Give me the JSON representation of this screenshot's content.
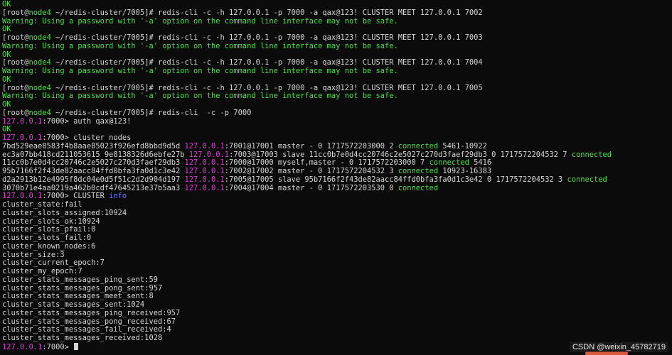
{
  "colors": {
    "background": "#0b0b0b",
    "text": "#d6d6d6",
    "green": "#4be04b",
    "magenta": "#e23bd9",
    "blue": "#6b7bf0",
    "cursor": "#d6d6d6"
  },
  "terminal": {
    "lines": [
      [
        {
          "t": "OK",
          "c": "green"
        }
      ],
      [
        {
          "t": "[root@",
          "c": "text"
        },
        {
          "t": "node4",
          "c": "green"
        },
        {
          "t": " ~/redis-cluster/7005]# redis-cli -c -h 127.0.0.1 -p 7000 -a qax@123! CLUSTER MEET 127.0.0.1 7002",
          "c": "text"
        }
      ],
      [
        {
          "t": "Warning: Using a password with '-a' option on the command line interface may not be safe.",
          "c": "green"
        }
      ],
      [
        {
          "t": "OK",
          "c": "green"
        }
      ],
      [
        {
          "t": "[root@",
          "c": "text"
        },
        {
          "t": "node4",
          "c": "green"
        },
        {
          "t": " ~/redis-cluster/7005]# redis-cli -c -h 127.0.0.1 -p 7000 -a qax@123! CLUSTER MEET 127.0.0.1 7003",
          "c": "text"
        }
      ],
      [
        {
          "t": "Warning: Using a password with '-a' option on the command line interface may not be safe.",
          "c": "green"
        }
      ],
      [
        {
          "t": "OK",
          "c": "green"
        }
      ],
      [
        {
          "t": "[root@",
          "c": "text"
        },
        {
          "t": "node4",
          "c": "green"
        },
        {
          "t": " ~/redis-cluster/7005]# redis-cli -c -h 127.0.0.1 -p 7000 -a qax@123! CLUSTER MEET 127.0.0.1 7004",
          "c": "text"
        }
      ],
      [
        {
          "t": "Warning: Using a password with '-a' option on the command line interface may not be safe.",
          "c": "green"
        }
      ],
      [
        {
          "t": "OK",
          "c": "green"
        }
      ],
      [
        {
          "t": "[root@",
          "c": "text"
        },
        {
          "t": "node4",
          "c": "green"
        },
        {
          "t": " ~/redis-cluster/7005]# redis-cli -c -h 127.0.0.1 -p 7000 -a qax@123! CLUSTER MEET 127.0.0.1 7005",
          "c": "text"
        }
      ],
      [
        {
          "t": "Warning: Using a password with '-a' option on the command line interface may not be safe.",
          "c": "green"
        }
      ],
      [
        {
          "t": "OK",
          "c": "green"
        }
      ],
      [
        {
          "t": "[root@",
          "c": "text"
        },
        {
          "t": "node4",
          "c": "green"
        },
        {
          "t": " ~/redis-cluster/7005]# redis-cli  -c -p 7000",
          "c": "text"
        }
      ],
      [
        {
          "t": "127.0.0.1",
          "c": "magenta"
        },
        {
          "t": ":7000> auth qax@123!",
          "c": "text"
        }
      ],
      [
        {
          "t": "OK",
          "c": "green"
        }
      ],
      [
        {
          "t": "127.0.0.1",
          "c": "magenta"
        },
        {
          "t": ":7000> cluster nodes",
          "c": "text"
        }
      ],
      [
        {
          "t": "7bd529eae8583f4b8aae85023f926efd8bbd9d5d ",
          "c": "text"
        },
        {
          "t": "127.0.0.1",
          "c": "magenta"
        },
        {
          "t": ":7001@17001 master - 0 1717572203000 2 ",
          "c": "text"
        },
        {
          "t": "connected",
          "c": "green"
        },
        {
          "t": " 5461-10922",
          "c": "text"
        }
      ],
      [
        {
          "t": "ec3a07bb418cd211053615 9e8138326d6ebfe27b ",
          "c": "text"
        },
        {
          "t": "127.0.0.1",
          "c": "magenta"
        },
        {
          "t": ":7003@17003 slave 11cc0b7e0d4cc20746c2e5027c270d3faef29db3 0 1717572204532 7 ",
          "c": "text"
        },
        {
          "t": "connected",
          "c": "green"
        }
      ],
      [
        {
          "t": "11cc0b7e0d4cc20746c2e5027c270d3faef29db3 ",
          "c": "text"
        },
        {
          "t": "127.0.0.1",
          "c": "magenta"
        },
        {
          "t": ":7000@17000 myself,master - 0 1717572203000 7 ",
          "c": "text"
        },
        {
          "t": "connected",
          "c": "green"
        },
        {
          "t": " 5416",
          "c": "text"
        }
      ],
      [
        {
          "t": "95b7166f2f43de82aacc84ffd0bfa3fa0d1c3e42 ",
          "c": "text"
        },
        {
          "t": "127.0.0.1",
          "c": "magenta"
        },
        {
          "t": ":7002@17002 master - 0 1717572204532 3 ",
          "c": "text"
        },
        {
          "t": "connected",
          "c": "green"
        },
        {
          "t": " 10923-16383",
          "c": "text"
        }
      ],
      [
        {
          "t": "d2a2913b12e4995f8dc04e0d5f51c2d2d904d197 ",
          "c": "text"
        },
        {
          "t": "127.0.0.1",
          "c": "magenta"
        },
        {
          "t": ":7005@17005 slave 95b7166f2f43de82aacc84ffd0bfa3fa0d1c3e42 0 1717572204532 3 ",
          "c": "text"
        },
        {
          "t": "connected",
          "c": "green"
        }
      ],
      [
        {
          "t": "3070b71e4aa0219a462b0cdf47645213e37b5aa3 ",
          "c": "text"
        },
        {
          "t": "127.0.0.1",
          "c": "magenta"
        },
        {
          "t": ":7004@17004 master - 0 1717572203530 0 ",
          "c": "text"
        },
        {
          "t": "connected",
          "c": "green"
        }
      ],
      [
        {
          "t": "127.0.0.1",
          "c": "magenta"
        },
        {
          "t": ":7000> CLUSTER ",
          "c": "text"
        },
        {
          "t": "info",
          "c": "blue"
        }
      ],
      [
        {
          "t": "cluster_state:fail",
          "c": "text"
        }
      ],
      [
        {
          "t": "cluster_slots_assigned:10924",
          "c": "text"
        }
      ],
      [
        {
          "t": "cluster_slots_ok:10924",
          "c": "text"
        }
      ],
      [
        {
          "t": "cluster_slots_pfail:0",
          "c": "text"
        }
      ],
      [
        {
          "t": "cluster_slots_fail:0",
          "c": "text"
        }
      ],
      [
        {
          "t": "cluster_known_nodes:6",
          "c": "text"
        }
      ],
      [
        {
          "t": "cluster_size:3",
          "c": "text"
        }
      ],
      [
        {
          "t": "cluster_current_epoch:7",
          "c": "text"
        }
      ],
      [
        {
          "t": "cluster_my_epoch:7",
          "c": "text"
        }
      ],
      [
        {
          "t": "cluster_stats_messages_ping_sent:59",
          "c": "text"
        }
      ],
      [
        {
          "t": "cluster_stats_messages_pong_sent:957",
          "c": "text"
        }
      ],
      [
        {
          "t": "cluster_stats_messages_meet_sent:8",
          "c": "text"
        }
      ],
      [
        {
          "t": "cluster_stats_messages_sent:1024",
          "c": "text"
        }
      ],
      [
        {
          "t": "cluster_stats_messages_ping_received:957",
          "c": "text"
        }
      ],
      [
        {
          "t": "cluster_stats_messages_pong_received:67",
          "c": "text"
        }
      ],
      [
        {
          "t": "cluster_stats_messages_fail_received:4",
          "c": "text"
        }
      ],
      [
        {
          "t": "cluster_stats_messages_received:1028",
          "c": "text"
        }
      ],
      [
        {
          "t": "127.0.0.1",
          "c": "magenta"
        },
        {
          "t": ":7000> ",
          "c": "text"
        }
      ]
    ]
  },
  "watermark": {
    "text": "CSDN @weixin_45782719"
  }
}
